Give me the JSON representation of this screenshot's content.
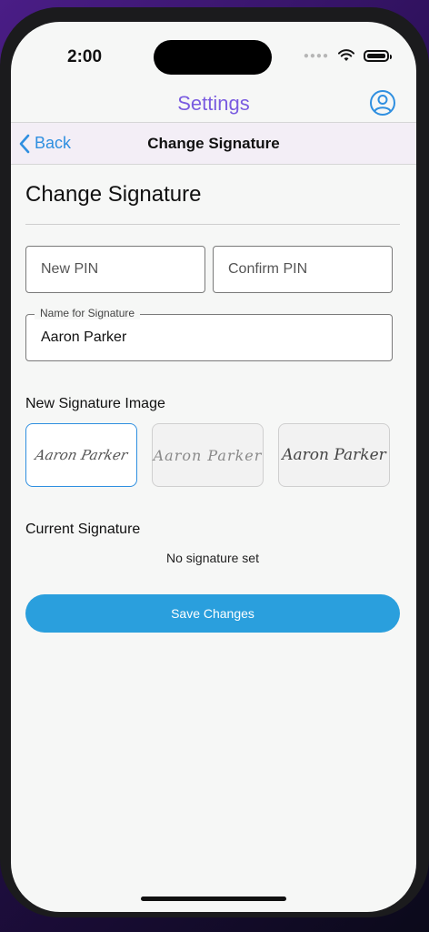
{
  "status": {
    "time": "2:00"
  },
  "app": {
    "title": "Settings"
  },
  "nav": {
    "back_label": "Back",
    "title": "Change Signature"
  },
  "page": {
    "title": "Change Signature"
  },
  "form": {
    "new_pin_placeholder": "New PIN",
    "confirm_pin_placeholder": "Confirm PIN",
    "name_label": "Name for Signature",
    "name_value": "Aaron Parker"
  },
  "signature_images": {
    "label": "New Signature Image",
    "options": [
      {
        "text": "Aaron Parker",
        "selected": true
      },
      {
        "text": "Aaron Parker",
        "selected": false
      },
      {
        "text": "Aaron Parker",
        "selected": false
      }
    ]
  },
  "current_signature": {
    "label": "Current Signature",
    "value": "No signature set"
  },
  "actions": {
    "save_label": "Save Changes"
  },
  "colors": {
    "accent": "#2a9fdd",
    "title": "#7a5ce0",
    "back": "#2f8fe0"
  },
  "icons": {
    "profile": "user-circle-icon",
    "back": "chevron-left-icon",
    "wifi": "wifi-icon",
    "battery": "battery-icon"
  }
}
